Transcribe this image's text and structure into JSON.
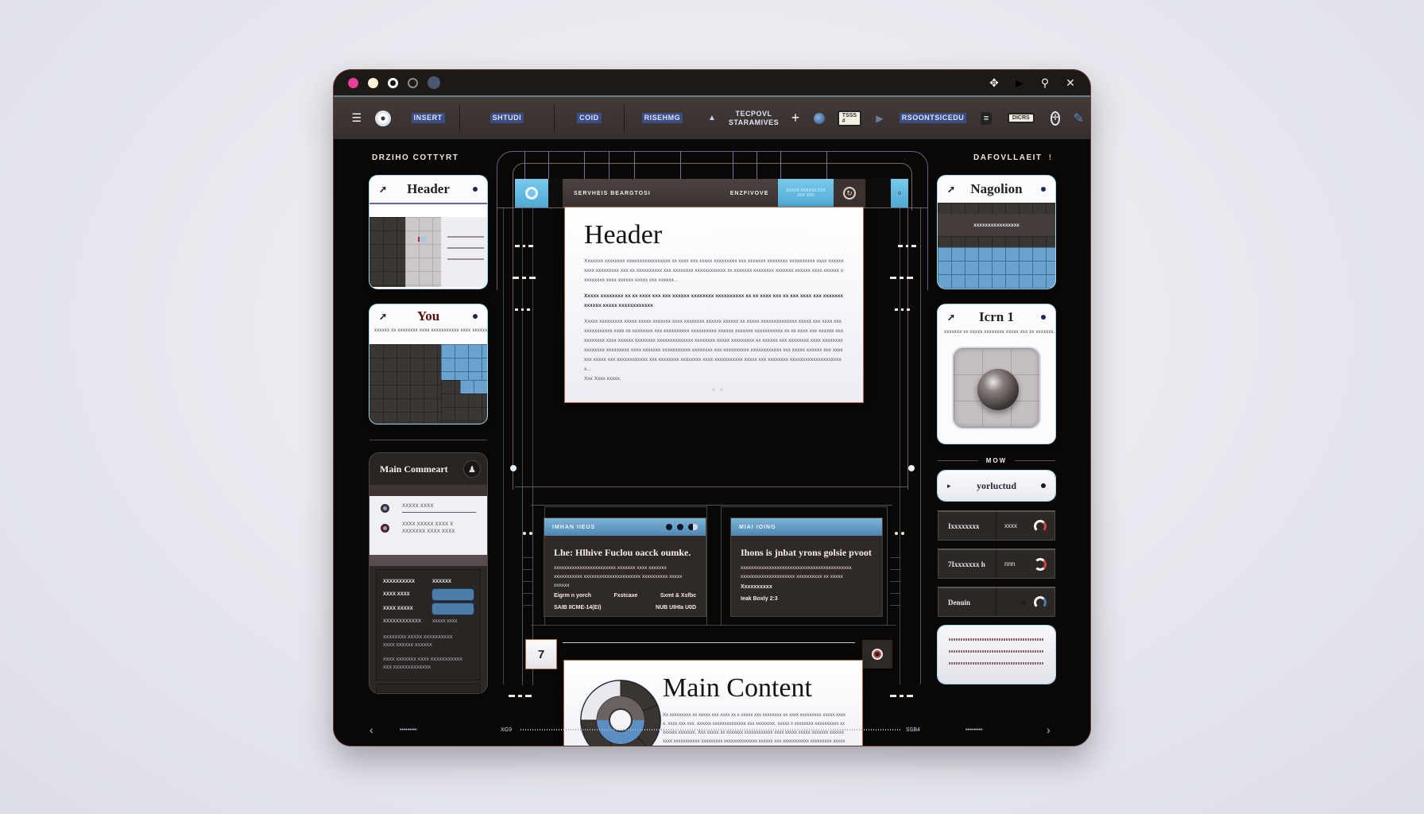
{
  "window": {
    "traffic_lights": [
      "close",
      "minimize",
      "maximize",
      "fullscreen",
      "extra"
    ],
    "title_icons": [
      "move-icon",
      "play-icon",
      "search-icon",
      "close-icon"
    ]
  },
  "toolbar": {
    "items": [
      {
        "label": "INSERT",
        "kind": "text"
      },
      {
        "label": "SHTUDI",
        "kind": "text"
      },
      {
        "label": "COID",
        "kind": "text"
      },
      {
        "label": "RISEHMG",
        "kind": "text"
      },
      {
        "label": "TECPOVL STARAMIVES",
        "kind": "text"
      },
      {
        "label": "RSOONTSICEDU",
        "kind": "text"
      }
    ],
    "badge1": "TSSS #",
    "badge2": "DICRS"
  },
  "left": {
    "section_label": "DRZIHO COTTYRT",
    "card1": {
      "title": "Header"
    },
    "card2": {
      "title": "You",
      "subtitle": "xxxxxx xx xxxxxxxx xxxx xxxxxxxxxxx xxxx xxxxxx"
    },
    "comment": {
      "title": "Main Commeart",
      "options": [
        {
          "label": "XXXXX XXXX"
        },
        {
          "label": "XXXX XXXXX XXXX X",
          "sub": "XXXXXXX XXXX XXXX"
        }
      ],
      "form_rows": [
        {
          "label": "XXXXXXXXXX",
          "value": "XXXXXX"
        },
        {
          "label": "XXXX XXXX",
          "value": ""
        },
        {
          "label": "XXXX XXXXX",
          "value": ""
        },
        {
          "label": "XXXXXXXXXXXX",
          "value": "XXXXX XXXX"
        }
      ],
      "notes": [
        "XXXXXXXX XXXXX XXXXXXXXXX",
        "XXXX XXXXXX XXXXXX",
        "XXXX XXXXXXX XXXX XXXXXXXXXXX",
        "XXX XXXXXXXXXXXXX"
      ]
    }
  },
  "center": {
    "topbar": {
      "label1": "SERVHEIS BEARGTOSI",
      "label2": "ENZFIVOVE",
      "label3": "XXXXX XXXXXX XXX XXX XXX"
    },
    "header_doc": {
      "title": "Header",
      "para1": "Xxxxxxx xxxxxxxx xxxxxxxxxxxxxxxxx xx xxxx xxx xxxxx xxxxxxxxx xxx xxxxxxx xxxxxxxx xxxxxxxxxx xxxx xxxxxx xxxx xxxxxxxxx xxx xx xxxxxxxxxx xxx xxxxxxxx xxxxxxxxxxxx xx xxxxxxx xxxxxxxx xxxxxxx xxxxxx xxxx xxxxxx xxxxxxxxx xxxx xxxxxx xxxxx xxx xxxxxx...",
      "para2": "Xxxxx xxxxxxxx xx xx xxxx xxx xxx xxxxxx xxxxxxxx xxxxxxxxxx xx xx xxxx xxx xx xxx xxxx xxx xxxxxxx xxxxxx xxxxx xxxxxxxxxxxx",
      "para3": "Xxxxx xxxxxxxxx xxxxx xxxxx xxxxxxx xxxx xxxxxxxx xxxxxx xxxxxx xx xxxxx xxxxxxxxxxxxxx xxxxx xxx xxxx xxxxxxxxxxxxxx xxxx xx xxxxxxxx xxx xxxxxxxxxx xxxxxxxxxx xxxxxx xxxxxxx xxxxxxxxxxx xx xx xxxx xxx xxxxxx xxxxxxxxxxx xxxx xxxxxx xxxxxxxx xxxxxxxxxxxxxx xxxxxxxx xxxxx xxxxxxxxx xx xxxxxx xxx xxxxxxxx xxxx xxxxxxxx xxxxxxxx xxxxxxxxx xxxx xxxxxxx xxxxxxxxxxx xxxxxxxx xxx xxxxxxxxxx xxxxxxxxxxxx xxx xxxxx xxxxxx xxx xxxxxxx xxxxx xxx xxxxxxxxxxxx xxx xxxxxxxx xxxxxxxx xxxx xxxxxxxxxxx xxxxx xxx xxxxxxxx xxxxxxxxxxxxxxxxxxxxx...",
      "tail": "Xxx Xxxx xxxxx."
    },
    "mini1": {
      "head": "IMHAN IIEUS",
      "title": "Lhe: Hlhive Fuclou oacck oumke.",
      "text": "xxxxxxxxxxxxxxxxxxxxxxxx xxxxxxx xxxx xxxxxxx xxxxxxxxxxx xxxxxxxxxxxxxxxxxxxxxx xxxxxxxxxx xxxxx xxxxxx",
      "row1": [
        "Eigrm n yorch",
        "Fxstcaxe",
        "Sxmt & Xsfbc"
      ],
      "row2": [
        "SAIB IICME-14(EI)",
        "NUB UIHIa U0D"
      ]
    },
    "mini2": {
      "head": "MIAI IOING",
      "title": "Ihons is jnbat yrons golsie pvoot",
      "text": "xxxxxxxxxxxxxxxxxxxxxxxxxxxxxxxxxxxxxxxxxxx xxxxxxxxxxxxxxxxxxxxx xxxxxxxxxx xx xxxxx",
      "row1": [
        "Xxxxxxxxxx"
      ],
      "row2": [
        "Ieak Boxly 2:3"
      ]
    },
    "page_number": "7",
    "main": {
      "title": "Main Content",
      "text": "Xx xxxxxxxxx xx xxxxx xxx xxxx xx x xxxxx xxx xxxxxxxx xx xxxx xxxxxxxxx xxxxx xxxxx. xxxx xxx xxx. xxxxxx xxxxxxxxxxxxxx xxx xxxxxxxx, xxxxx x xxxxxxxx xxxxxxxxxx xxxxxxxx xxxxxxx. Xxx xxxxx xx xxxxxxx xxxxxxxxxxxx xxxx xxxxx xxxxx xxxxxxx xxxxxxxxxx xxxxxxxxxxx xxxxxxxxx xxxxxxxxxxxxxx xxxxxx xxx xxxxxxxxxxx xxxxxxxxx xxxxx xxxxxxxxx xxxxx xxxxxxx xxxxxxxxx xxxxxxxx xxxxxx. xxxxxxxxxxxxxx xxxx xxxx..."
    },
    "donut": {
      "segments": [
        {
          "label": "light",
          "value": 25,
          "color": "#e8e8ee"
        },
        {
          "label": "dark",
          "value": 75,
          "color": "#3b3532"
        }
      ],
      "inner_fill_fraction": 0.5,
      "inner_color": "#5b8fc4"
    }
  },
  "right": {
    "section_label": "DAFOVLLAEIT",
    "card1": {
      "title": "Nagolion",
      "subtitle": "xxxxxxxxxxxxxxxx"
    },
    "card2": {
      "title": "Icrn 1",
      "subtitle": "xxxxxxx xx xxxxx xxxxxxxx xxxxx xxx xx xxxxxxx."
    },
    "divider_label": "MOW",
    "selected": {
      "title": "yorluctud"
    },
    "rows": [
      {
        "c1": "Ixxxxxxxx",
        "c2": "xxxx"
      },
      {
        "c1": "7Ixxxxxxx h",
        "c2": "nnn"
      },
      {
        "c1": "Denuin",
        "c2": "+"
      }
    ]
  },
  "bottom": {
    "left_dots": "• • • • • • • • •",
    "start": "XG9",
    "end": "SSB4",
    "right_dots": "• • • • • • • • •"
  }
}
